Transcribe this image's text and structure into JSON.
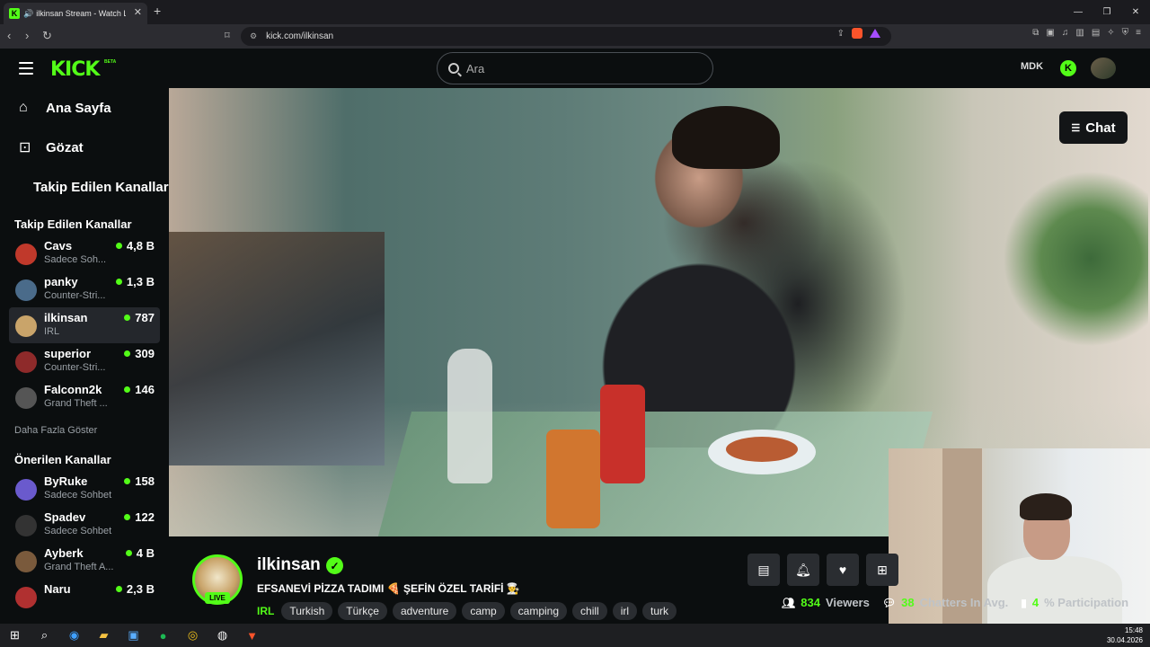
{
  "browser": {
    "tab_title": "ilkinsan Stream - Watch Live",
    "url": "kick.com/ilkinsan"
  },
  "header": {
    "logo": "KICK",
    "logo_badge": "BETA",
    "search_placeholder": "Ara",
    "mdk_label": "MDK"
  },
  "sidebar": {
    "nav": [
      {
        "label": "Ana Sayfa",
        "icon": "home-icon"
      },
      {
        "label": "Gözat",
        "icon": "browse-icon"
      },
      {
        "label": "Takip Edilen Kanallar",
        "icon": "heart-icon"
      }
    ],
    "followed_title": "Takip Edilen Kanallar",
    "followed": [
      {
        "name": "Cavs",
        "category": "Sadece Soh...",
        "viewers": "4,8 B",
        "color": "#c0392b"
      },
      {
        "name": "panky",
        "category": "Counter-Stri...",
        "viewers": "1,3 B",
        "color": "#4a6b8a"
      },
      {
        "name": "ilkinsan",
        "category": "IRL",
        "viewers": "787",
        "color": "#c9a46a"
      },
      {
        "name": "superior",
        "category": "Counter-Stri...",
        "viewers": "309",
        "color": "#8e2a2a"
      },
      {
        "name": "Falconn2k",
        "category": "Grand Theft ...",
        "viewers": "146",
        "color": "#555555"
      }
    ],
    "show_more": "Daha Fazla Göster",
    "recommended_title": "Önerilen Kanallar",
    "recommended": [
      {
        "name": "ByRuke",
        "category": "Sadece Sohbet",
        "viewers": "158",
        "color": "#6a5acd"
      },
      {
        "name": "Spadev",
        "category": "Sadece Sohbet",
        "viewers": "122",
        "color": "#333333"
      },
      {
        "name": "Ayberk",
        "category": "Grand Theft A...",
        "viewers": "4 B",
        "color": "#7a5a3c"
      },
      {
        "name": "Naru",
        "category": "",
        "viewers": "2,3 B",
        "color": "#b03030"
      }
    ]
  },
  "player": {
    "chat_button": "Chat"
  },
  "stream": {
    "streamer": "ilkinsan",
    "live_label": "LIVE",
    "title": "EFSANEVİ PİZZA TADIMI 🍕 ŞEFİN ÖZEL TARİFİ 👨‍🍳",
    "category": "IRL",
    "tags": [
      "Turkish",
      "Türkçe",
      "adventure",
      "camp",
      "camping",
      "chill",
      "irl",
      "turk"
    ],
    "viewers_value": "834",
    "viewers_label": "Viewers",
    "chatters_value": "38",
    "chatters_label": "Chatters In Avg.",
    "participation_value": "4",
    "participation_label": "% Participation"
  },
  "taskbar": {
    "time": "15:48",
    "date": "30.04.2026"
  }
}
